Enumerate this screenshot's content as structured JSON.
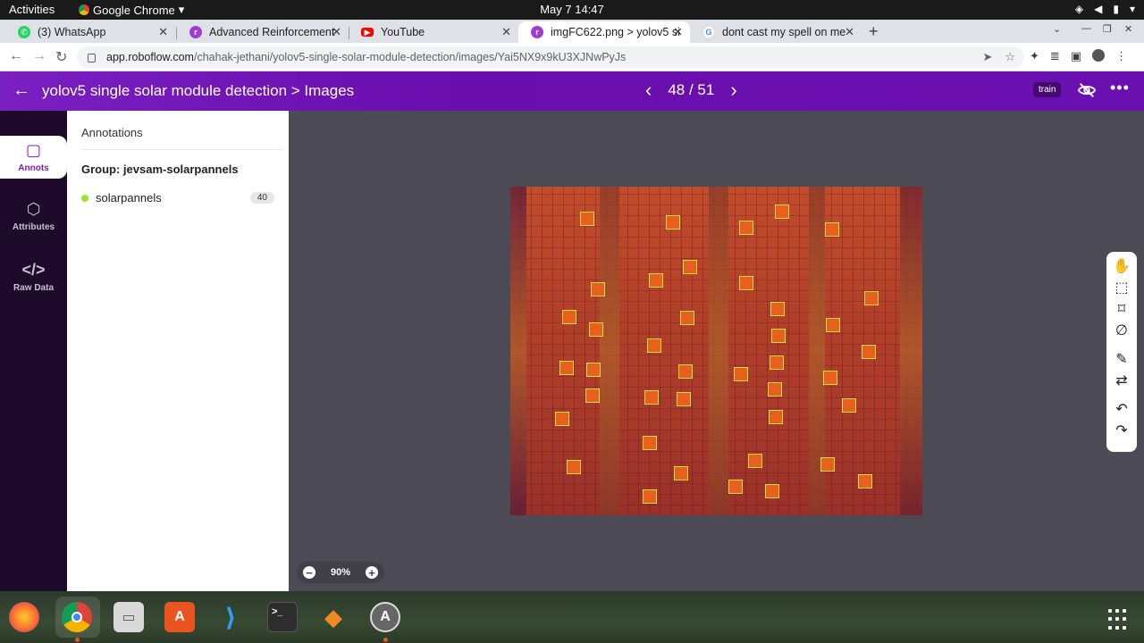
{
  "system_bar": {
    "activities": "Activities",
    "app_name": "Google Chrome",
    "clock": "May 7  14:47"
  },
  "tabs": [
    {
      "title": "(3) WhatsApp",
      "favicon": "whatsapp-icon",
      "color": "#25d366"
    },
    {
      "title": "Advanced Reinforcement",
      "favicon": "roboflow-icon",
      "color": "#a23bd6"
    },
    {
      "title": "YouTube",
      "favicon": "youtube-icon",
      "color": "#ff0000"
    },
    {
      "title": "imgFC622.png > yolov5 si",
      "favicon": "roboflow-icon",
      "color": "#a23bd6",
      "active": true
    },
    {
      "title": "dont cast my spell on me",
      "favicon": "google-icon",
      "color": "#4285f4"
    }
  ],
  "address_bar": {
    "host": "app.roboflow.com",
    "path": "/chahak-jethani/yolov5-single-solar-module-detection/images/Yai5NX9x9kU3XJNwPyJs"
  },
  "header": {
    "breadcrumb": "yolov5 single solar module detection > Images",
    "page_counter": "48 / 51",
    "split_badge": "train"
  },
  "left_nav": {
    "items": [
      {
        "label": "Annots",
        "icon": "annotation-icon",
        "active": true
      },
      {
        "label": "Attributes",
        "icon": "tag-icon"
      },
      {
        "label": "Raw Data",
        "icon": "code-icon"
      }
    ]
  },
  "annotations_panel": {
    "heading": "Annotations",
    "group": "Group: jevsam-solarpannels",
    "classes": [
      {
        "name": "solarpannels",
        "count": "40",
        "color": "#9be42b"
      }
    ]
  },
  "canvas": {
    "zoom_level": "90%",
    "bbox_color": "#f8e04a"
  },
  "toolbar_tools": [
    {
      "name": "hand-icon",
      "active": true
    },
    {
      "name": "bounding-box-icon"
    },
    {
      "name": "polygon-icon"
    },
    {
      "name": "null-icon"
    },
    {
      "name": "smart-polygon-icon"
    },
    {
      "name": "repeat-icon"
    },
    {
      "name": "undo-icon"
    },
    {
      "name": "redo-icon"
    }
  ],
  "colors": {
    "accent": "#7a1fc2",
    "sidebar": "#1e0a2b",
    "canvas_bg": "#4c4b55"
  }
}
